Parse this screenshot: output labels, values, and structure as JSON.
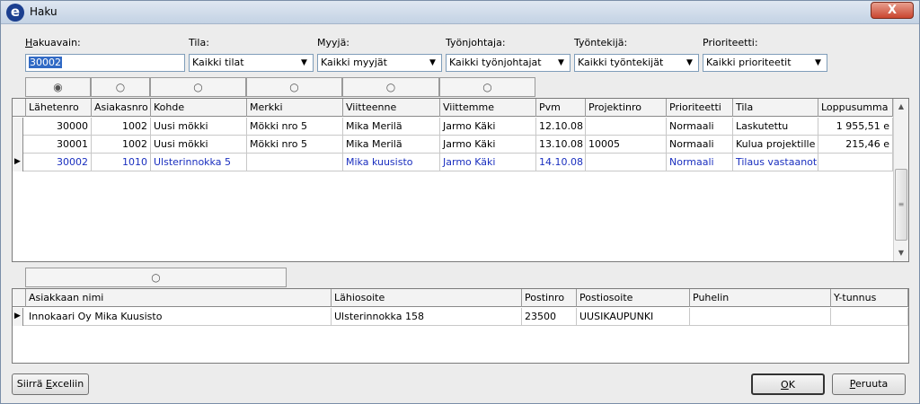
{
  "window": {
    "title": "Haku",
    "close_glyph": "X",
    "app_icon_letter": "e"
  },
  "filters": {
    "hakuavain": {
      "label_u": "H",
      "label_rest": "akuavain:",
      "value": "30002"
    },
    "tila": {
      "label": "Tila:",
      "value": "Kaikki tilat"
    },
    "myyja": {
      "label": "Myyjä:",
      "value": "Kaikki myyjät"
    },
    "tyonjohtaja": {
      "label": "Työnjohtaja:",
      "value": "Kaikki työnjohtajat"
    },
    "tyontekija": {
      "label": "Työntekijä:",
      "value": "Kaikki työntekijät"
    },
    "prioriteetti": {
      "label": "Prioriteetti:",
      "value": "Kaikki prioriteetit"
    }
  },
  "orders": {
    "radio_glyph_selected": "◉",
    "radio_glyph": "○",
    "columns": [
      "Lähetenro",
      "Asiakasnro",
      "Kohde",
      "Merkki",
      "Viitteenne",
      "Viittemme",
      "Pvm",
      "Projektinro",
      "Prioriteetti",
      "Tila",
      "Loppusumma"
    ],
    "rows": [
      [
        "30000",
        "1002",
        "Uusi mökki",
        "Mökki nro 5",
        "Mika Merilä",
        "Jarmo Käki",
        "12.10.08",
        "",
        "Normaali",
        "Laskutettu",
        "1 955,51 e"
      ],
      [
        "30001",
        "1002",
        "Uusi mökki",
        "Mökki nro 5",
        "Mika Merilä",
        "Jarmo Käki",
        "13.10.08",
        "10005",
        "Normaali",
        "Kulua projektille",
        "215,46 e"
      ],
      [
        "30002",
        "1010",
        "Ulsterinnokka 5",
        "",
        "Mika kuusisto",
        "Jarmo Käki",
        "14.10.08",
        "",
        "Normaali",
        "Tilaus vastaanotettu",
        ""
      ]
    ],
    "current_row_marker": "▶",
    "scroll_up": "▲",
    "scroll_down": "▼",
    "scroll_grip": "≡"
  },
  "customer": {
    "columns": [
      "Asiakkaan nimi",
      "Lähiosoite",
      "Postinro",
      "Postiosoite",
      "Puhelin",
      "Y-tunnus"
    ],
    "rows": [
      [
        "Innokaari Oy Mika Kuusisto",
        "Ulsterinnokka 158",
        "23500",
        "UUSIKAUPUNKI",
        "",
        ""
      ]
    ],
    "current_row_marker": "▶"
  },
  "buttons": {
    "excel": {
      "pre": "Siirrä ",
      "u": "E",
      "post": "xceliin"
    },
    "ok": {
      "u": "O",
      "post": "K"
    },
    "cancel": {
      "pre": "",
      "u": "P",
      "post": "eruuta"
    }
  }
}
